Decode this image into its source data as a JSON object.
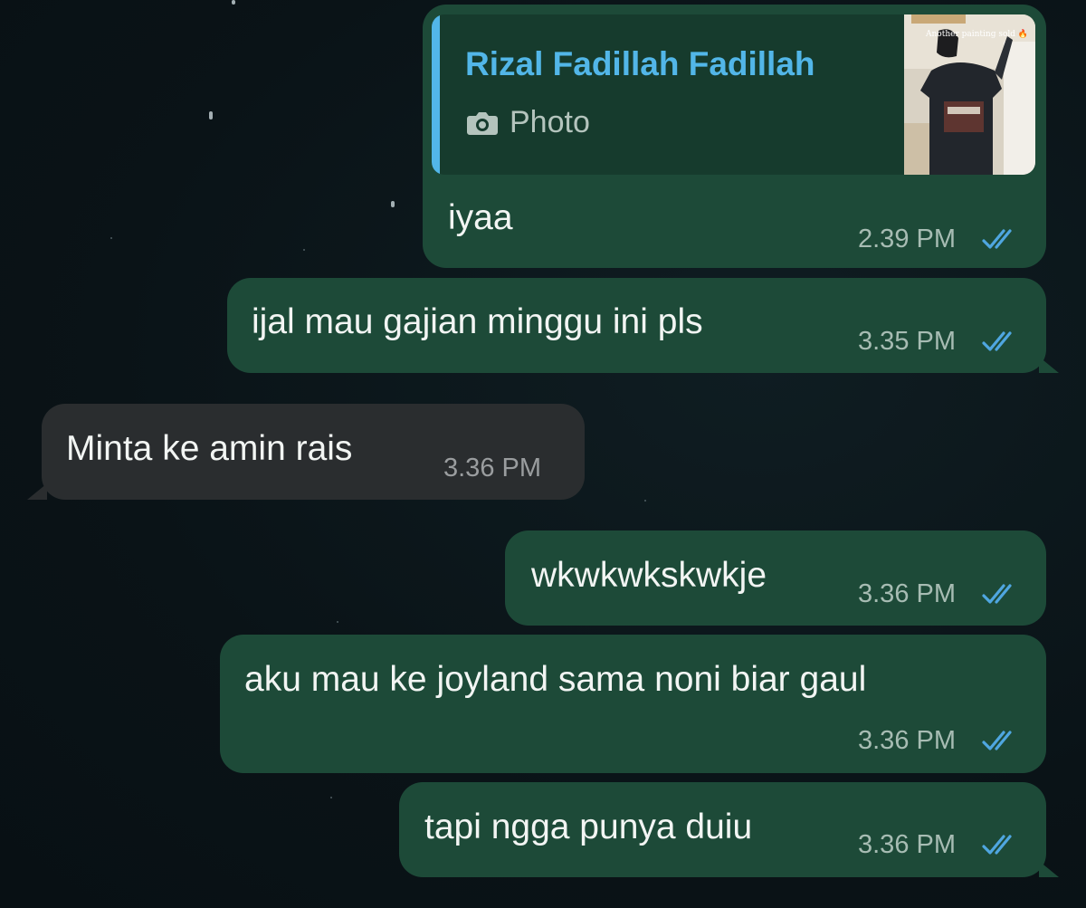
{
  "colors": {
    "outgoing_bubble": "#1d4a38",
    "incoming_bubble": "#2a2d2f",
    "reply_accent": "#52b6e8",
    "read_ticks": "#4fa6e0"
  },
  "messages": [
    {
      "direction": "outgoing",
      "reply": {
        "name": "Rizal Fadillah Fadillah",
        "type_icon": "camera-icon",
        "type_label": "Photo",
        "thumbnail_caption": "Another painting sold 🔥"
      },
      "text": "iyaa",
      "time": "2.39 PM",
      "status": "read"
    },
    {
      "direction": "outgoing",
      "text": "ijal mau gajian minggu ini pls",
      "time": "3.35 PM",
      "status": "read"
    },
    {
      "direction": "incoming",
      "text": "Minta ke amin rais",
      "time": "3.36 PM"
    },
    {
      "direction": "outgoing",
      "text": "wkwkwkskwkje",
      "time": "3.36 PM",
      "status": "read"
    },
    {
      "direction": "outgoing",
      "text": "aku mau ke joyland sama noni biar gaul",
      "time": "3.36 PM",
      "status": "read"
    },
    {
      "direction": "outgoing",
      "text": "tapi ngga punya duiu",
      "time": "3.36 PM",
      "status": "read"
    }
  ]
}
